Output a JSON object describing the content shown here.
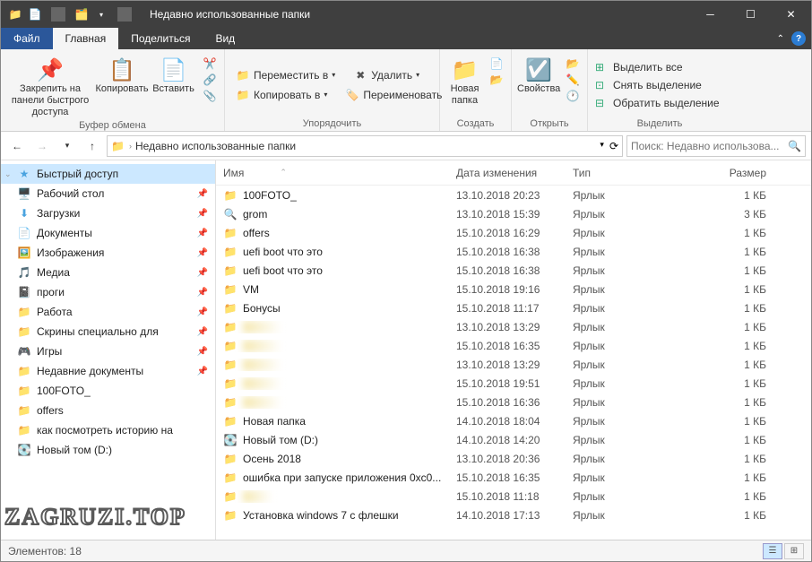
{
  "window": {
    "title": "Недавно использованные папки"
  },
  "tabs": {
    "file": "Файл",
    "home": "Главная",
    "share": "Поделиться",
    "view": "Вид"
  },
  "ribbon": {
    "clipboard": {
      "pin": "Закрепить на панели быстрого доступа",
      "copy": "Копировать",
      "paste": "Вставить",
      "group_label": "Буфер обмена"
    },
    "organize": {
      "move_to": "Переместить в",
      "copy_to": "Копировать в",
      "delete": "Удалить",
      "rename": "Переименовать",
      "group_label": "Упорядочить"
    },
    "new": {
      "new_folder": "Новая папка",
      "group_label": "Создать"
    },
    "open": {
      "properties": "Свойства",
      "group_label": "Открыть"
    },
    "select": {
      "select_all": "Выделить все",
      "select_none": "Снять выделение",
      "invert": "Обратить выделение",
      "group_label": "Выделить"
    }
  },
  "addressbar": {
    "path": "Недавно использованные папки"
  },
  "search": {
    "placeholder": "Поиск: Недавно использова..."
  },
  "sidebar": [
    {
      "icon": "star",
      "label": "Быстрый доступ",
      "selected": true,
      "expandable": true
    },
    {
      "icon": "desktop",
      "label": "Рабочий стол",
      "pinned": true
    },
    {
      "icon": "download",
      "label": "Загрузки",
      "pinned": true
    },
    {
      "icon": "doc",
      "label": "Документы",
      "pinned": true
    },
    {
      "icon": "image",
      "label": "Изображения",
      "pinned": true
    },
    {
      "icon": "media",
      "label": "Медиа",
      "pinned": true
    },
    {
      "icon": "folder-dark",
      "label": "проги",
      "pinned": true
    },
    {
      "icon": "folder-green",
      "label": "Работа",
      "pinned": true
    },
    {
      "icon": "folder-green",
      "label": "Скрины специально для ",
      "pinned": true
    },
    {
      "icon": "games",
      "label": "Игры",
      "pinned": true
    },
    {
      "icon": "folder-orange",
      "label": "Недавние документы",
      "pinned": true
    },
    {
      "icon": "folder",
      "label": "100FOTO_"
    },
    {
      "icon": "folder",
      "label": "offers"
    },
    {
      "icon": "folder",
      "label": "как посмотреть историю на"
    },
    {
      "icon": "drive",
      "label": "Новый том (D:)"
    }
  ],
  "columns": {
    "name": "Имя",
    "date": "Дата изменения",
    "type": "Тип",
    "size": "Размер"
  },
  "files": [
    {
      "icon": "folder",
      "name": "100FOTO_",
      "date": "13.10.2018 20:23",
      "type": "Ярлык",
      "size": "1 КБ"
    },
    {
      "icon": "search",
      "name": "grom",
      "date": "13.10.2018 15:39",
      "type": "Ярлык",
      "size": "3 КБ"
    },
    {
      "icon": "folder",
      "name": "offers",
      "date": "15.10.2018 16:29",
      "type": "Ярлык",
      "size": "1 КБ"
    },
    {
      "icon": "folder",
      "name": "uefi boot что это",
      "date": "15.10.2018 16:38",
      "type": "Ярлык",
      "size": "1 КБ"
    },
    {
      "icon": "folder",
      "name": "uefi boot что это",
      "date": "15.10.2018 16:38",
      "type": "Ярлык",
      "size": "1 КБ"
    },
    {
      "icon": "folder",
      "name": "VM",
      "date": "15.10.2018 19:16",
      "type": "Ярлык",
      "size": "1 КБ"
    },
    {
      "icon": "folder",
      "name": "Бонусы",
      "date": "15.10.2018 11:17",
      "type": "Ярлык",
      "size": "1 КБ"
    },
    {
      "icon": "folder",
      "name": "hidden1",
      "date": "13.10.2018 13:29",
      "type": "Ярлык",
      "size": "1 КБ",
      "blurred": true
    },
    {
      "icon": "folder",
      "name": "hidden2",
      "date": "15.10.2018 16:35",
      "type": "Ярлык",
      "size": "1 КБ",
      "blurred": true
    },
    {
      "icon": "folder",
      "name": "hidden3",
      "date": "13.10.2018 13:29",
      "type": "Ярлык",
      "size": "1 КБ",
      "blurred": true
    },
    {
      "icon": "folder",
      "name": "hidden4",
      "date": "15.10.2018 19:51",
      "type": "Ярлык",
      "size": "1 КБ",
      "blurred": true
    },
    {
      "icon": "folder",
      "name": "hidden5",
      "date": "15.10.2018 16:36",
      "type": "Ярлык",
      "size": "1 КБ",
      "blurred": true
    },
    {
      "icon": "folder",
      "name": "Новая папка",
      "date": "14.10.2018 18:04",
      "type": "Ярлык",
      "size": "1 КБ"
    },
    {
      "icon": "drive",
      "name": "Новый том (D:)",
      "date": "14.10.2018 14:20",
      "type": "Ярлык",
      "size": "1 КБ"
    },
    {
      "icon": "folder",
      "name": "Осень 2018",
      "date": "13.10.2018 20:36",
      "type": "Ярлык",
      "size": "1 КБ"
    },
    {
      "icon": "folder",
      "name": "ошибка при запуске приложения 0xc0...",
      "date": "15.10.2018 16:35",
      "type": "Ярлык",
      "size": "1 КБ"
    },
    {
      "icon": "folder",
      "name": "Почта",
      "date": "15.10.2018 11:18",
      "type": "Ярлык",
      "size": "1 КБ",
      "blurred": true
    },
    {
      "icon": "folder",
      "name": "Установка windows 7 с флешки",
      "date": "14.10.2018 17:13",
      "type": "Ярлык",
      "size": "1 КБ"
    }
  ],
  "statusbar": {
    "count_label": "Элементов: 18"
  },
  "watermark": "ZAGRUZI.TOP"
}
